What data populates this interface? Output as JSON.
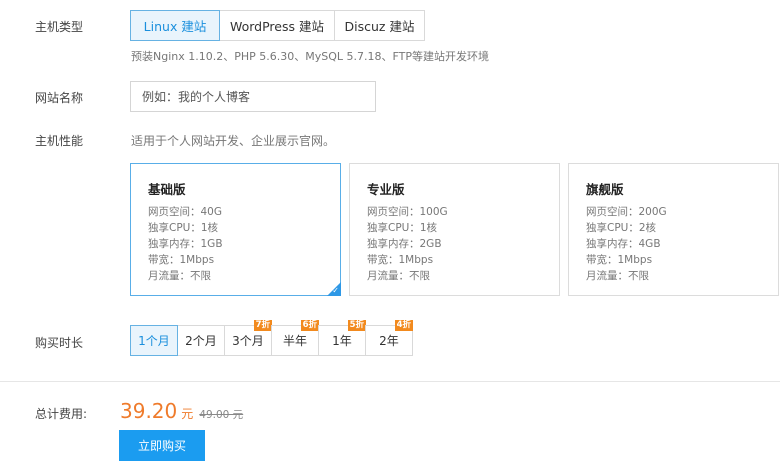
{
  "host_type": {
    "label": "主机类型",
    "options": [
      "Linux 建站",
      "WordPress 建站",
      "Discuz 建站"
    ],
    "selected": "Linux 建站",
    "hint": "预装Nginx 1.10.2、PHP 5.6.30、MySQL 5.7.18、FTP等建站开发环境"
  },
  "site_name": {
    "label": "网站名称",
    "placeholder": "例如：我的个人博客"
  },
  "performance": {
    "label": "主机性能",
    "description": "适用于个人网站开发、企业展示官网。",
    "plans": [
      {
        "title": "基础版",
        "specs": [
          "网页空间：40G",
          "独享CPU：1核",
          "独享内存：1GB",
          "带宽：1Mbps",
          "月流量：不限"
        ]
      },
      {
        "title": "专业版",
        "specs": [
          "网页空间：100G",
          "独享CPU：1核",
          "独享内存：2GB",
          "带宽：1Mbps",
          "月流量：不限"
        ]
      },
      {
        "title": "旗舰版",
        "specs": [
          "网页空间：200G",
          "独享CPU：2核",
          "独享内存：4GB",
          "带宽：1Mbps",
          "月流量：不限"
        ]
      }
    ],
    "selected": "基础版"
  },
  "duration": {
    "label": "购买时长",
    "options": [
      {
        "label": "1个月",
        "badge": ""
      },
      {
        "label": "2个月",
        "badge": ""
      },
      {
        "label": "3个月",
        "badge": "7折"
      },
      {
        "label": "半年",
        "badge": "6折"
      },
      {
        "label": "1年",
        "badge": "5折"
      },
      {
        "label": "2年",
        "badge": "4折"
      }
    ],
    "selected": "1个月"
  },
  "total": {
    "label": "总计费用:",
    "amount": "39.20",
    "unit": "元",
    "original": "49.00 元"
  },
  "buy_button": "立即购买",
  "colors": {
    "accent": "#1b9cf0",
    "price": "#ef7b2b",
    "badge": "#f28a1e",
    "selected_bg": "#e9f4fc"
  }
}
